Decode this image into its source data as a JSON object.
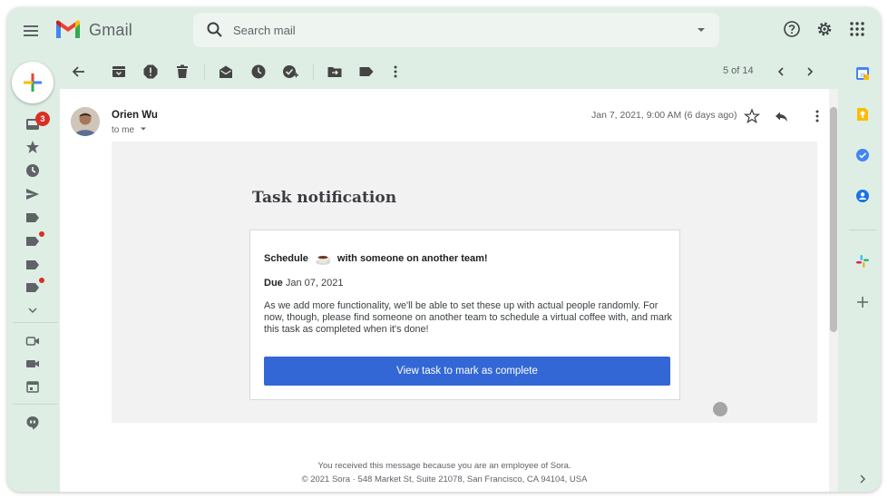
{
  "header": {
    "app_name": "Gmail",
    "search_placeholder": "Search mail"
  },
  "rail": {
    "inbox_unread": "3"
  },
  "toolbar": {
    "pager": "5 of 14"
  },
  "message": {
    "sender": "Orien Wu",
    "recipient": "to me",
    "date": "Jan 7, 2021, 9:00 AM (6 days ago)"
  },
  "email": {
    "title": "Task notification",
    "task_before": "Schedule",
    "task_after": "with someone on another team!",
    "due_label": "Due",
    "due_date": "Jan 07, 2021",
    "description": "As we add more functionality, we'll be able to set these up with actual people randomly. For now, though, please find someone on another team to schedule a virtual coffee with, and mark this task as completed when it's done!",
    "cta": "View task to mark as complete",
    "footer_line1": "You received this message because you are an employee of Sora.",
    "footer_line2": "© 2021 Sora · 548 Market St, Suite 21078, San Francisco, CA 94104, USA"
  },
  "colors": {
    "background": "#dfeee4",
    "cta": "#3367d6",
    "badge": "#d93025"
  }
}
